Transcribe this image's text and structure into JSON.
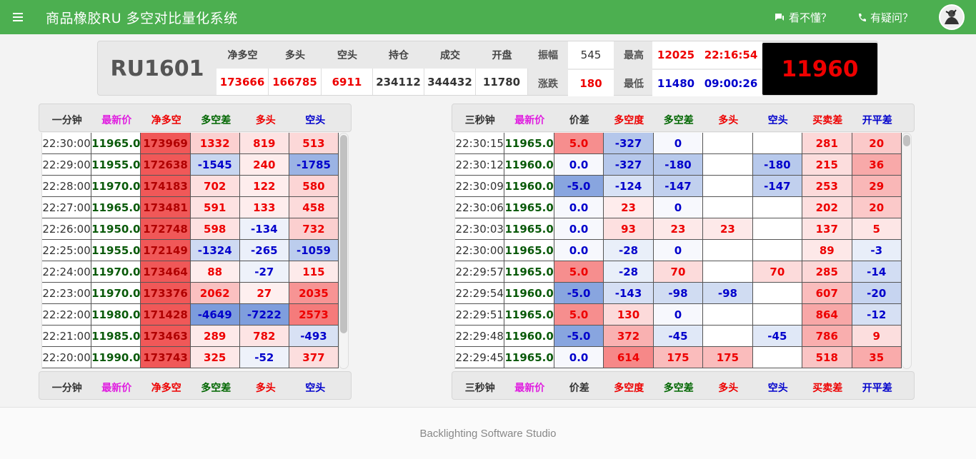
{
  "app": {
    "title": "商品橡胶RU 多空对比量化系统",
    "help_label": "看不懂？",
    "question_label": "有疑问？"
  },
  "quote": {
    "symbol": "RU1601",
    "cols": [
      {
        "label": "净多空",
        "value": "173666"
      },
      {
        "label": "多头",
        "value": "166785"
      },
      {
        "label": "空头",
        "value": "6911"
      },
      {
        "label": "持仓",
        "value": "234112"
      },
      {
        "label": "成交",
        "value": "344432"
      },
      {
        "label": "开盘",
        "value": "11780"
      }
    ],
    "amp_label": "振幅",
    "amp_value": "545",
    "chg_label": "涨跌",
    "chg_value": "180",
    "high_label": "最高",
    "high_value": "12025",
    "high_time": "22:16:54",
    "low_label": "最低",
    "low_value": "11480",
    "low_time": "09:00:26",
    "last": "11960"
  },
  "left": {
    "headers": [
      "一分钟",
      "最新价",
      "净多空",
      "多空差",
      "多头",
      "空头"
    ],
    "rows": [
      [
        "22:30:00",
        "11965.0",
        "173969",
        "1332",
        "819",
        "513"
      ],
      [
        "22:29:00",
        "11955.0",
        "172638",
        "-1545",
        "240",
        "-1785"
      ],
      [
        "22:28:00",
        "11970.0",
        "174183",
        "702",
        "122",
        "580"
      ],
      [
        "22:27:00",
        "11965.0",
        "173481",
        "591",
        "133",
        "458"
      ],
      [
        "22:26:00",
        "11950.0",
        "172748",
        "598",
        "-134",
        "732"
      ],
      [
        "22:25:00",
        "11955.0",
        "172149",
        "-1324",
        "-265",
        "-1059"
      ],
      [
        "22:24:00",
        "11970.0",
        "173464",
        "88",
        "-27",
        "115"
      ],
      [
        "22:23:00",
        "11970.0",
        "173376",
        "2062",
        "27",
        "2035"
      ],
      [
        "22:22:00",
        "11980.0",
        "171428",
        "-4649",
        "-7222",
        "2573"
      ],
      [
        "22:21:00",
        "11985.0",
        "173463",
        "289",
        "782",
        "-493"
      ],
      [
        "22:20:00",
        "11990.0",
        "173743",
        "325",
        "-52",
        "377"
      ]
    ]
  },
  "right": {
    "headers": [
      "三秒钟",
      "最新价",
      "价差",
      "多空度",
      "多空差",
      "多头",
      "空头",
      "买卖差",
      "开平差"
    ],
    "rows": [
      [
        "22:30:15",
        "11965.0",
        "5.0",
        "-327",
        "0",
        "",
        "",
        "281",
        "20"
      ],
      [
        "22:30:12",
        "11960.0",
        "0.0",
        "-327",
        "-180",
        "",
        "-180",
        "215",
        "36"
      ],
      [
        "22:30:09",
        "11960.0",
        "-5.0",
        "-124",
        "-147",
        "",
        "-147",
        "253",
        "29"
      ],
      [
        "22:30:06",
        "11965.0",
        "0.0",
        "23",
        "0",
        "",
        "",
        "202",
        "20"
      ],
      [
        "22:30:03",
        "11965.0",
        "0.0",
        "93",
        "23",
        "23",
        "",
        "137",
        "5"
      ],
      [
        "22:30:00",
        "11965.0",
        "0.0",
        "-28",
        "0",
        "",
        "",
        "89",
        "-3"
      ],
      [
        "22:29:57",
        "11965.0",
        "5.0",
        "-28",
        "70",
        "",
        "70",
        "285",
        "-14"
      ],
      [
        "22:29:54",
        "11960.0",
        "-5.0",
        "-143",
        "-98",
        "-98",
        "",
        "607",
        "-20"
      ],
      [
        "22:29:51",
        "11965.0",
        "5.0",
        "130",
        "0",
        "",
        "",
        "864",
        "-12"
      ],
      [
        "22:29:48",
        "11960.0",
        "-5.0",
        "372",
        "-45",
        "",
        "-45",
        "786",
        "9"
      ],
      [
        "22:29:45",
        "11965.0",
        "0.0",
        "614",
        "175",
        "175",
        "",
        "518",
        "35"
      ]
    ]
  },
  "footer": "Backlighting Software Studio",
  "colors": {
    "brand": "#4caf50",
    "up": "#e00000",
    "down": "#0000cc"
  }
}
